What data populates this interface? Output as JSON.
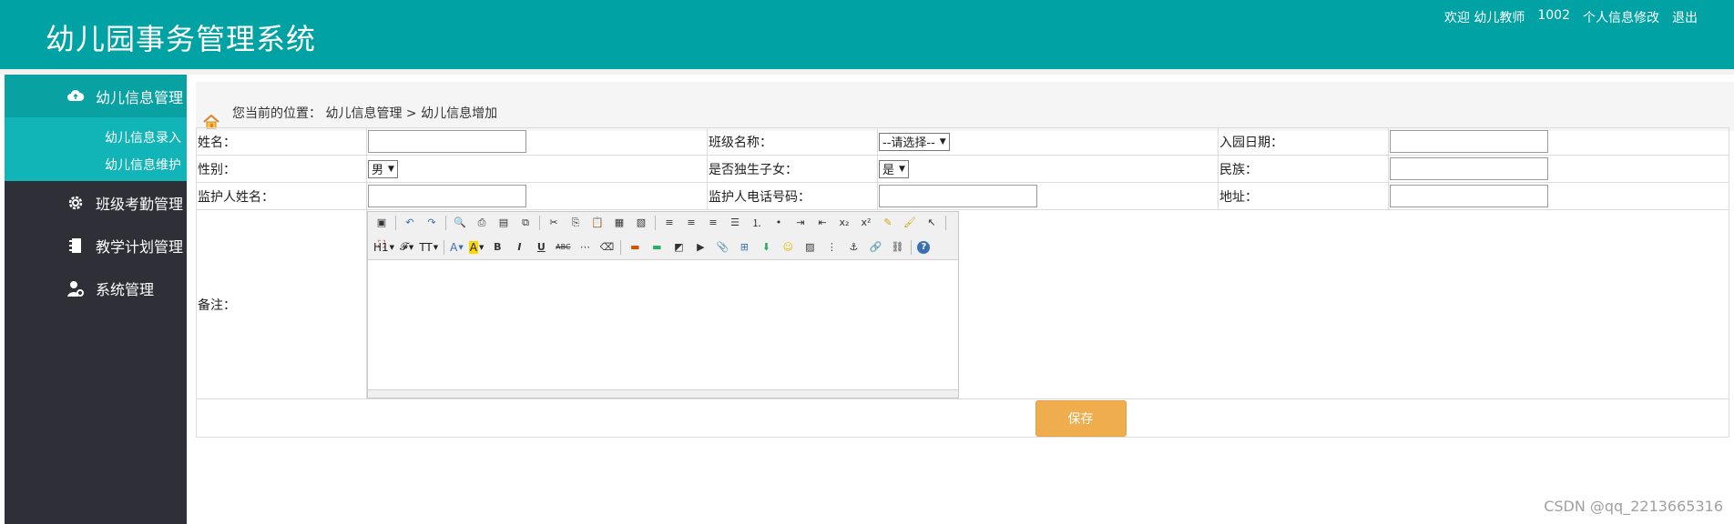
{
  "header": {
    "title": "幼儿园事务管理系统",
    "welcome": "欢迎 幼儿教师",
    "user_id": "1002",
    "profile_link": "个人信息修改",
    "logout_link": "退出"
  },
  "sidebar": {
    "items": [
      {
        "label": "幼儿信息管理",
        "icon": "cloud-icon",
        "active": true,
        "subitems": [
          "幼儿信息录入",
          "幼儿信息维护"
        ]
      },
      {
        "label": "班级考勤管理",
        "icon": "gear-icon"
      },
      {
        "label": "教学计划管理",
        "icon": "notebook-icon"
      },
      {
        "label": "系统管理",
        "icon": "user-settings-icon"
      }
    ]
  },
  "breadcrumb": "您当前的位置： 幼儿信息管理 > 幼儿信息增加",
  "form": {
    "name_label": "姓名：",
    "class_label": "班级名称：",
    "class_select": "--请选择--",
    "enroll_label": "入园日期：",
    "gender_label": "性别：",
    "gender_select": "男",
    "only_child_label": "是否独生子女：",
    "only_child_select": "是",
    "ethnicity_label": "民族：",
    "guardian_name_label": "监护人姓名：",
    "guardian_phone_label": "监护人电话号码：",
    "address_label": "地址：",
    "remark_label": "备注：",
    "save_label": "保存"
  },
  "editor": {
    "heading_menu": "H1",
    "font_menu": "𝓕",
    "size_menu": "TT",
    "font_color": "A",
    "highlight": "A",
    "bold": "B",
    "italic": "I",
    "underline": "U",
    "strike": "ABC"
  },
  "watermark": "CSDN @qq_2213665316",
  "colors": {
    "header": "#00a2a4",
    "sidebar": "#2f2f38",
    "active": "#0aa1a3",
    "submenu": "#12b5b7",
    "save": "#f0ad4e"
  }
}
